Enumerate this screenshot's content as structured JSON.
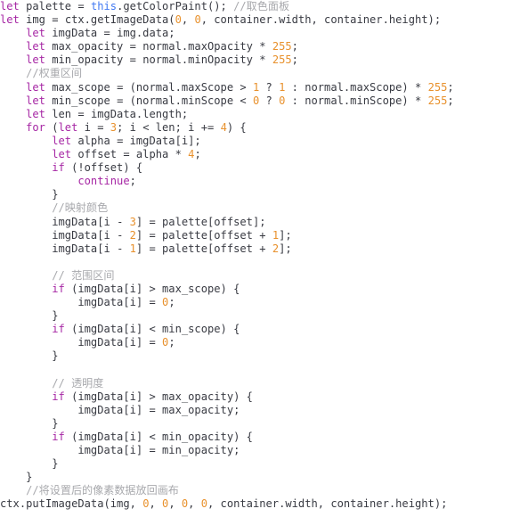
{
  "editor": {
    "language": "javascript",
    "background_color": "#ffffff",
    "theme_colors": {
      "keyword": "#a626a4",
      "builtin": "#4078f2",
      "number": "#e8912d",
      "comment": "#a8a9ad",
      "plain": "#383a42"
    },
    "lines": [
      {
        "indent": 0,
        "tokens": [
          {
            "t": "let",
            "c": "kw"
          },
          {
            "t": " palette ",
            "c": "plain"
          },
          {
            "t": "= ",
            "c": "op"
          },
          {
            "t": "this",
            "c": "builtin"
          },
          {
            "t": ".getColorPaint(); ",
            "c": "plain"
          },
          {
            "t": "//取色面板",
            "c": "com"
          }
        ]
      },
      {
        "indent": 0,
        "tokens": [
          {
            "t": "let",
            "c": "kw"
          },
          {
            "t": " img ",
            "c": "plain"
          },
          {
            "t": "= ",
            "c": "op"
          },
          {
            "t": "ctx.getImageData(",
            "c": "plain"
          },
          {
            "t": "0",
            "c": "num"
          },
          {
            "t": ", ",
            "c": "plain"
          },
          {
            "t": "0",
            "c": "num"
          },
          {
            "t": ", container.width, container.height);",
            "c": "plain"
          }
        ]
      },
      {
        "indent": 4,
        "tokens": [
          {
            "t": "let",
            "c": "kw"
          },
          {
            "t": " imgData ",
            "c": "plain"
          },
          {
            "t": "= ",
            "c": "op"
          },
          {
            "t": "img.data;",
            "c": "plain"
          }
        ]
      },
      {
        "indent": 4,
        "tokens": [
          {
            "t": "let",
            "c": "kw"
          },
          {
            "t": " max_opacity ",
            "c": "plain"
          },
          {
            "t": "= ",
            "c": "op"
          },
          {
            "t": "normal.maxOpacity ",
            "c": "plain"
          },
          {
            "t": "* ",
            "c": "op"
          },
          {
            "t": "255",
            "c": "num"
          },
          {
            "t": ";",
            "c": "plain"
          }
        ]
      },
      {
        "indent": 4,
        "tokens": [
          {
            "t": "let",
            "c": "kw"
          },
          {
            "t": " min_opacity ",
            "c": "plain"
          },
          {
            "t": "= ",
            "c": "op"
          },
          {
            "t": "normal.minOpacity ",
            "c": "plain"
          },
          {
            "t": "* ",
            "c": "op"
          },
          {
            "t": "255",
            "c": "num"
          },
          {
            "t": ";",
            "c": "plain"
          }
        ]
      },
      {
        "indent": 4,
        "tokens": [
          {
            "t": "//权重区间",
            "c": "com"
          }
        ]
      },
      {
        "indent": 4,
        "tokens": [
          {
            "t": "let",
            "c": "kw"
          },
          {
            "t": " max_scope ",
            "c": "plain"
          },
          {
            "t": "= ",
            "c": "op"
          },
          {
            "t": "(normal.maxScope ",
            "c": "plain"
          },
          {
            "t": "> ",
            "c": "op"
          },
          {
            "t": "1",
            "c": "num"
          },
          {
            "t": " ? ",
            "c": "op"
          },
          {
            "t": "1",
            "c": "num"
          },
          {
            "t": " : ",
            "c": "op"
          },
          {
            "t": "normal.maxScope) ",
            "c": "plain"
          },
          {
            "t": "* ",
            "c": "op"
          },
          {
            "t": "255",
            "c": "num"
          },
          {
            "t": ";",
            "c": "plain"
          }
        ]
      },
      {
        "indent": 4,
        "tokens": [
          {
            "t": "let",
            "c": "kw"
          },
          {
            "t": " min_scope ",
            "c": "plain"
          },
          {
            "t": "= ",
            "c": "op"
          },
          {
            "t": "(normal.minScope ",
            "c": "plain"
          },
          {
            "t": "< ",
            "c": "op"
          },
          {
            "t": "0",
            "c": "num"
          },
          {
            "t": " ? ",
            "c": "op"
          },
          {
            "t": "0",
            "c": "num"
          },
          {
            "t": " : ",
            "c": "op"
          },
          {
            "t": "normal.minScope) ",
            "c": "plain"
          },
          {
            "t": "* ",
            "c": "op"
          },
          {
            "t": "255",
            "c": "num"
          },
          {
            "t": ";",
            "c": "plain"
          }
        ]
      },
      {
        "indent": 4,
        "tokens": [
          {
            "t": "let",
            "c": "kw"
          },
          {
            "t": " len ",
            "c": "plain"
          },
          {
            "t": "= ",
            "c": "op"
          },
          {
            "t": "imgData.length;",
            "c": "plain"
          }
        ]
      },
      {
        "indent": 4,
        "tokens": [
          {
            "t": "for",
            "c": "kw"
          },
          {
            "t": " (",
            "c": "plain"
          },
          {
            "t": "let",
            "c": "kw"
          },
          {
            "t": " i ",
            "c": "plain"
          },
          {
            "t": "= ",
            "c": "op"
          },
          {
            "t": "3",
            "c": "num"
          },
          {
            "t": "; i ",
            "c": "plain"
          },
          {
            "t": "< ",
            "c": "op"
          },
          {
            "t": "len; i ",
            "c": "plain"
          },
          {
            "t": "+= ",
            "c": "op"
          },
          {
            "t": "4",
            "c": "num"
          },
          {
            "t": ") {",
            "c": "plain"
          }
        ]
      },
      {
        "indent": 8,
        "tokens": [
          {
            "t": "let",
            "c": "kw"
          },
          {
            "t": " alpha ",
            "c": "plain"
          },
          {
            "t": "= ",
            "c": "op"
          },
          {
            "t": "imgData[i];",
            "c": "plain"
          }
        ]
      },
      {
        "indent": 8,
        "tokens": [
          {
            "t": "let",
            "c": "kw"
          },
          {
            "t": " offset ",
            "c": "plain"
          },
          {
            "t": "= ",
            "c": "op"
          },
          {
            "t": "alpha ",
            "c": "plain"
          },
          {
            "t": "* ",
            "c": "op"
          },
          {
            "t": "4",
            "c": "num"
          },
          {
            "t": ";",
            "c": "plain"
          }
        ]
      },
      {
        "indent": 8,
        "tokens": [
          {
            "t": "if",
            "c": "kw"
          },
          {
            "t": " (!offset) {",
            "c": "plain"
          }
        ]
      },
      {
        "indent": 12,
        "tokens": [
          {
            "t": "continue",
            "c": "kw"
          },
          {
            "t": ";",
            "c": "plain"
          }
        ]
      },
      {
        "indent": 8,
        "tokens": [
          {
            "t": "}",
            "c": "plain"
          }
        ]
      },
      {
        "indent": 8,
        "tokens": [
          {
            "t": "//映射颜色",
            "c": "com"
          }
        ]
      },
      {
        "indent": 8,
        "tokens": [
          {
            "t": "imgData[i ",
            "c": "plain"
          },
          {
            "t": "- ",
            "c": "op"
          },
          {
            "t": "3",
            "c": "num"
          },
          {
            "t": "] ",
            "c": "plain"
          },
          {
            "t": "= ",
            "c": "op"
          },
          {
            "t": "palette[offset];",
            "c": "plain"
          }
        ]
      },
      {
        "indent": 8,
        "tokens": [
          {
            "t": "imgData[i ",
            "c": "plain"
          },
          {
            "t": "- ",
            "c": "op"
          },
          {
            "t": "2",
            "c": "num"
          },
          {
            "t": "] ",
            "c": "plain"
          },
          {
            "t": "= ",
            "c": "op"
          },
          {
            "t": "palette[offset ",
            "c": "plain"
          },
          {
            "t": "+ ",
            "c": "op"
          },
          {
            "t": "1",
            "c": "num"
          },
          {
            "t": "];",
            "c": "plain"
          }
        ]
      },
      {
        "indent": 8,
        "tokens": [
          {
            "t": "imgData[i ",
            "c": "plain"
          },
          {
            "t": "- ",
            "c": "op"
          },
          {
            "t": "1",
            "c": "num"
          },
          {
            "t": "] ",
            "c": "plain"
          },
          {
            "t": "= ",
            "c": "op"
          },
          {
            "t": "palette[offset ",
            "c": "plain"
          },
          {
            "t": "+ ",
            "c": "op"
          },
          {
            "t": "2",
            "c": "num"
          },
          {
            "t": "];",
            "c": "plain"
          }
        ]
      },
      {
        "indent": 0,
        "tokens": []
      },
      {
        "indent": 8,
        "tokens": [
          {
            "t": "// 范围区间",
            "c": "com"
          }
        ]
      },
      {
        "indent": 8,
        "tokens": [
          {
            "t": "if",
            "c": "kw"
          },
          {
            "t": " (imgData[i] ",
            "c": "plain"
          },
          {
            "t": "> ",
            "c": "op"
          },
          {
            "t": "max_scope) {",
            "c": "plain"
          }
        ]
      },
      {
        "indent": 12,
        "tokens": [
          {
            "t": "imgData[i] ",
            "c": "plain"
          },
          {
            "t": "= ",
            "c": "op"
          },
          {
            "t": "0",
            "c": "num"
          },
          {
            "t": ";",
            "c": "plain"
          }
        ]
      },
      {
        "indent": 8,
        "tokens": [
          {
            "t": "}",
            "c": "plain"
          }
        ]
      },
      {
        "indent": 8,
        "tokens": [
          {
            "t": "if",
            "c": "kw"
          },
          {
            "t": " (imgData[i] ",
            "c": "plain"
          },
          {
            "t": "< ",
            "c": "op"
          },
          {
            "t": "min_scope) {",
            "c": "plain"
          }
        ]
      },
      {
        "indent": 12,
        "tokens": [
          {
            "t": "imgData[i] ",
            "c": "plain"
          },
          {
            "t": "= ",
            "c": "op"
          },
          {
            "t": "0",
            "c": "num"
          },
          {
            "t": ";",
            "c": "plain"
          }
        ]
      },
      {
        "indent": 8,
        "tokens": [
          {
            "t": "}",
            "c": "plain"
          }
        ]
      },
      {
        "indent": 0,
        "tokens": []
      },
      {
        "indent": 8,
        "tokens": [
          {
            "t": "// 透明度",
            "c": "com"
          }
        ]
      },
      {
        "indent": 8,
        "tokens": [
          {
            "t": "if",
            "c": "kw"
          },
          {
            "t": " (imgData[i] ",
            "c": "plain"
          },
          {
            "t": "> ",
            "c": "op"
          },
          {
            "t": "max_opacity) {",
            "c": "plain"
          }
        ]
      },
      {
        "indent": 12,
        "tokens": [
          {
            "t": "imgData[i] ",
            "c": "plain"
          },
          {
            "t": "= ",
            "c": "op"
          },
          {
            "t": "max_opacity;",
            "c": "plain"
          }
        ]
      },
      {
        "indent": 8,
        "tokens": [
          {
            "t": "}",
            "c": "plain"
          }
        ]
      },
      {
        "indent": 8,
        "tokens": [
          {
            "t": "if",
            "c": "kw"
          },
          {
            "t": " (imgData[i] ",
            "c": "plain"
          },
          {
            "t": "< ",
            "c": "op"
          },
          {
            "t": "min_opacity) {",
            "c": "plain"
          }
        ]
      },
      {
        "indent": 12,
        "tokens": [
          {
            "t": "imgData[i] ",
            "c": "plain"
          },
          {
            "t": "= ",
            "c": "op"
          },
          {
            "t": "min_opacity;",
            "c": "plain"
          }
        ]
      },
      {
        "indent": 8,
        "tokens": [
          {
            "t": "}",
            "c": "plain"
          }
        ]
      },
      {
        "indent": 4,
        "tokens": [
          {
            "t": "}",
            "c": "plain"
          }
        ]
      },
      {
        "indent": 4,
        "tokens": [
          {
            "t": "//将设置后的像素数据放回画布",
            "c": "com"
          }
        ]
      },
      {
        "indent": 0,
        "tokens": [
          {
            "t": "ctx.putImageData(img, ",
            "c": "plain"
          },
          {
            "t": "0",
            "c": "num"
          },
          {
            "t": ", ",
            "c": "plain"
          },
          {
            "t": "0",
            "c": "num"
          },
          {
            "t": ", ",
            "c": "plain"
          },
          {
            "t": "0",
            "c": "num"
          },
          {
            "t": ", ",
            "c": "plain"
          },
          {
            "t": "0",
            "c": "num"
          },
          {
            "t": ", container.width, container.height);",
            "c": "plain"
          }
        ]
      }
    ]
  }
}
